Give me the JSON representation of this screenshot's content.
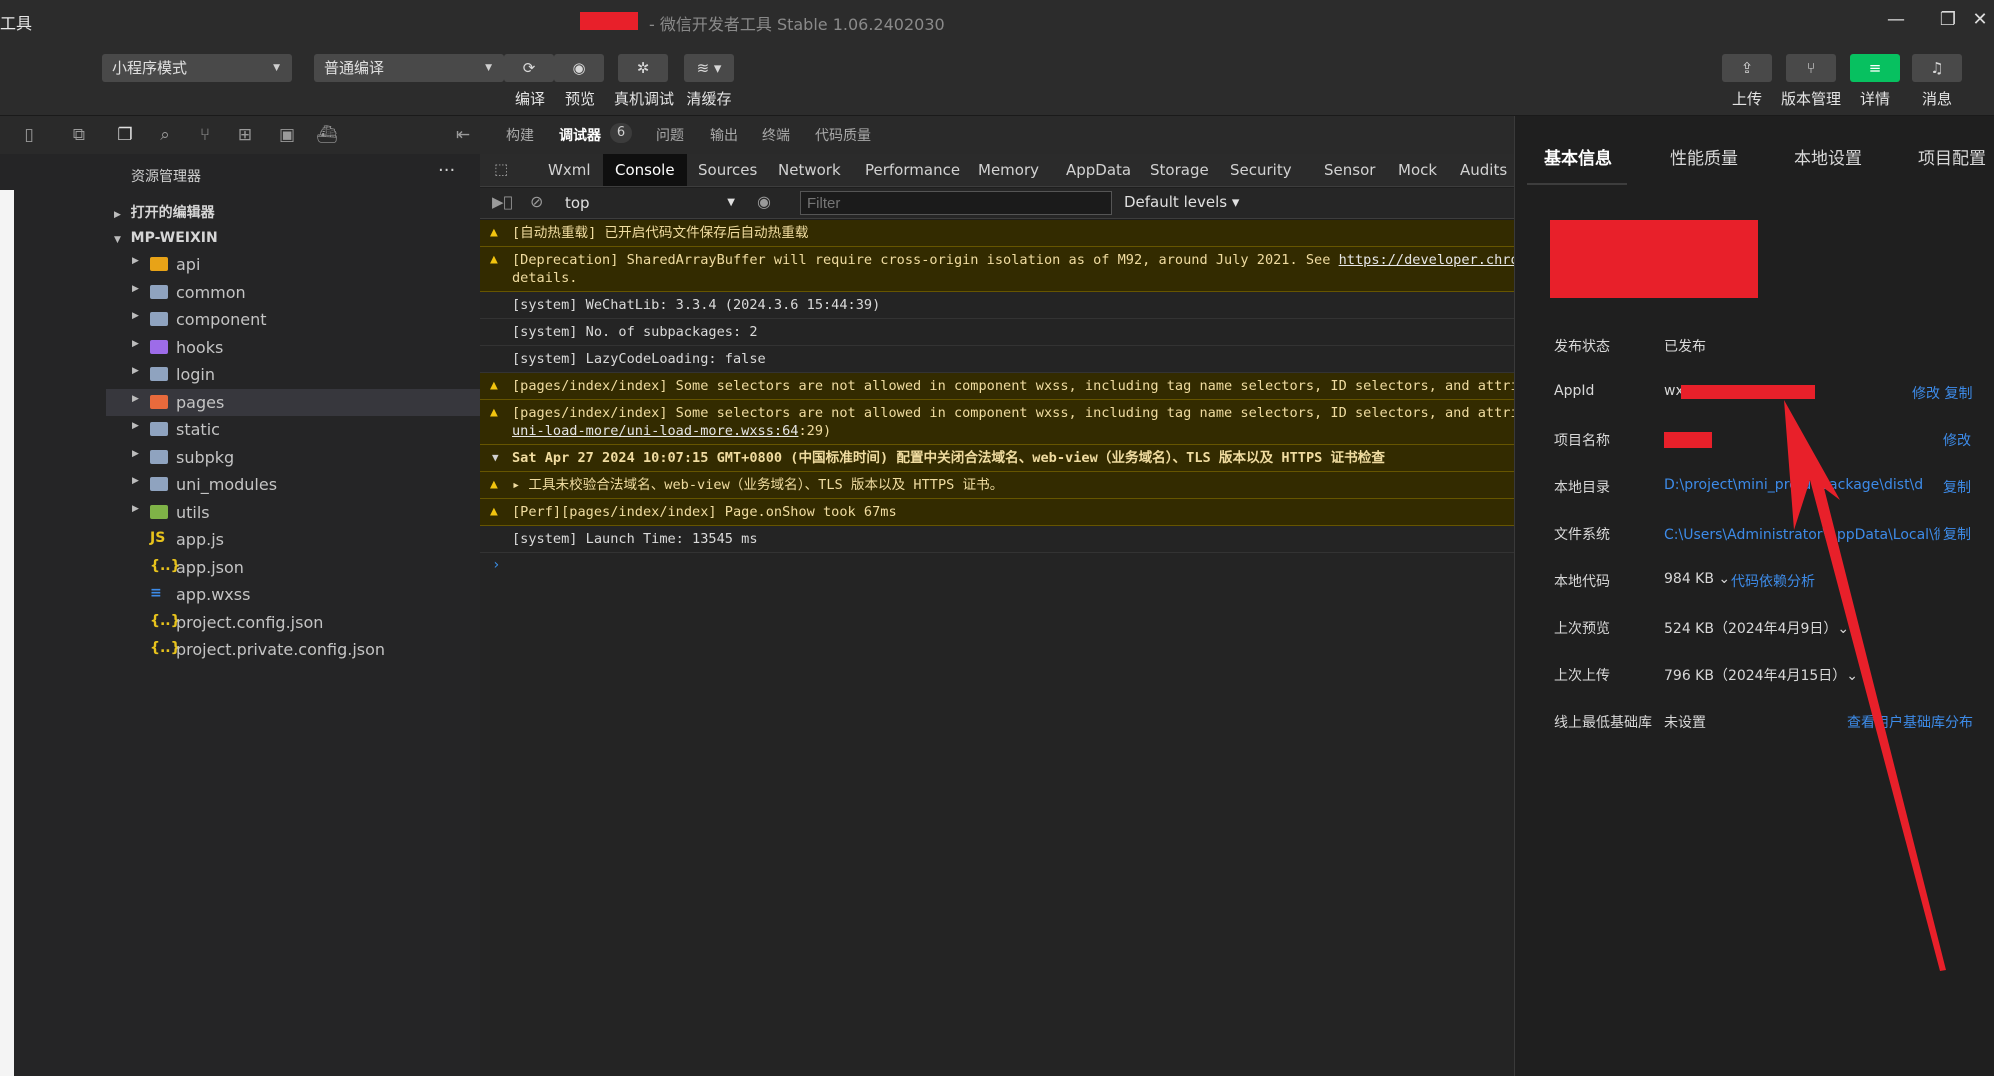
{
  "titlebar": {
    "app_label": "工具",
    "window_title": "- 微信开发者工具 Stable 1.06.2402030",
    "minimize": "—",
    "maximize": "❐",
    "close": "✕"
  },
  "toolbar": {
    "mode_select": "小程序模式",
    "compile_select": "普通编译",
    "buttons": {
      "compile": "编译",
      "preview": "预览",
      "device_debug": "真机调试",
      "clear_cache": "清缓存",
      "upload": "上传",
      "version": "版本管理",
      "details": "详情",
      "messages": "消息"
    }
  },
  "explorer": {
    "title": "资源管理器",
    "more": "···",
    "open_editors": "打开的编辑器",
    "project": "MP-WEIXIN",
    "items": [
      {
        "name": "api",
        "type": "folder",
        "color": "#e8a317"
      },
      {
        "name": "common",
        "type": "folder",
        "color": "#8fa3bf"
      },
      {
        "name": "component",
        "type": "folder",
        "color": "#8fa3bf"
      },
      {
        "name": "hooks",
        "type": "folder",
        "color": "#9d6ce8"
      },
      {
        "name": "login",
        "type": "folder",
        "color": "#8fa3bf"
      },
      {
        "name": "pages",
        "type": "folder",
        "color": "#e86a3c"
      },
      {
        "name": "static",
        "type": "folder",
        "color": "#8fa3bf"
      },
      {
        "name": "subpkg",
        "type": "folder",
        "color": "#8fa3bf"
      },
      {
        "name": "uni_modules",
        "type": "folder",
        "color": "#8fa3bf"
      },
      {
        "name": "utils",
        "type": "folder",
        "color": "#7fb347"
      },
      {
        "name": "app.js",
        "type": "js",
        "glyph": "JS",
        "color": "#e8c31c"
      },
      {
        "name": "app.json",
        "type": "json",
        "glyph": "{..}",
        "color": "#e8c31c"
      },
      {
        "name": "app.wxss",
        "type": "css",
        "glyph": "≡",
        "color": "#3d8be8"
      },
      {
        "name": "project.config.json",
        "type": "json",
        "glyph": "{..}",
        "color": "#e8c31c"
      },
      {
        "name": "project.private.config.json",
        "type": "json",
        "glyph": "{..}",
        "color": "#e8c31c"
      }
    ]
  },
  "devtools": {
    "top_tabs": [
      "构建",
      "调试器",
      "问题",
      "输出",
      "终端",
      "代码质量"
    ],
    "debugger_badge": "6",
    "panel_tabs": [
      "Wxml",
      "Console",
      "Sources",
      "Network",
      "Performance",
      "Memory",
      "AppData",
      "Storage",
      "Security",
      "Sensor",
      "Mock",
      "Audits"
    ],
    "context": "top",
    "filter_placeholder": "Filter",
    "levels": "Default levels ▾"
  },
  "console": {
    "logs": [
      {
        "level": "warn",
        "text": "[自动热重载] 已开启代码文件保存后自动热重载"
      },
      {
        "level": "warn",
        "text": "[Deprecation] SharedArrayBuffer will require cross-origin isolation as of M92, around July 2021. See ",
        "link": "https://developer.chrome.com/blog/enabling-shared-array-buffer/",
        "text2": "details."
      },
      {
        "level": "info",
        "text": "[system] WeChatLib: 3.3.4 (2024.3.6 15:44:39)"
      },
      {
        "level": "info",
        "text": "[system] No. of subpackages: 2"
      },
      {
        "level": "info",
        "text": "[system] LazyCodeLoading: false"
      },
      {
        "level": "warn",
        "text": "[pages/index/index] Some selectors are not allowed in component wxss, including tag name selectors, ID selectors, and attribute selectors."
      },
      {
        "level": "warn",
        "text": "[pages/index/index] Some selectors are not allowed in component wxss, including tag name selectors, ID selectors, and attribute selectors.",
        "link2": "uni-load-more/uni-load-more.wxss:64",
        "text2": ":29)"
      },
      {
        "level": "group",
        "text": "Sat Apr 27 2024 10:07:15 GMT+0800 (中国标准时间) 配置中关闭合法域名、web-view（业务域名）、TLS 版本以及 HTTPS 证书检查"
      },
      {
        "level": "warn",
        "text": "▸ 工具未校验合法域名、web-view（业务域名）、TLS 版本以及 HTTPS 证书。"
      },
      {
        "level": "warn",
        "text": "[Perf][pages/index/index] Page.onShow took 67ms"
      },
      {
        "level": "info",
        "text": "[system] Launch Time: 13545 ms"
      }
    ],
    "prompt": "›"
  },
  "right_panel": {
    "tabs": [
      "基本信息",
      "性能质量",
      "本地设置",
      "项目配置"
    ],
    "rows": {
      "publish_status": {
        "label": "发布状态",
        "value": "已发布"
      },
      "appid": {
        "label": "AppId",
        "value": "wx",
        "actions": "修改 复制"
      },
      "project_name": {
        "label": "项目名称",
        "actions": "修改"
      },
      "local_dir": {
        "label": "本地目录",
        "value": "D:\\project\\mini_pro\\unpackage\\dist\\dev\\m...",
        "actions": "复制"
      },
      "file_system": {
        "label": "文件系统",
        "value": "C:\\Users\\Administrator\\AppData\\Local\\微信...",
        "actions": "复制"
      },
      "local_code": {
        "label": "本地代码",
        "value": "984 KB ⌄",
        "link": "代码依赖分析"
      },
      "last_preview": {
        "label": "上次预览",
        "value": "524 KB（2024年4月9日）⌄"
      },
      "last_upload": {
        "label": "上次上传",
        "value": "796 KB（2024年4月15日）⌄"
      },
      "min_lib": {
        "label": "线上最低基础库",
        "value": "未设置",
        "link": "查看用户基础库分布"
      }
    }
  },
  "colors": {
    "accent_green": "#07c160",
    "annotation_red": "#e8202a",
    "link_blue": "#3d8be8",
    "warning_yellow": "#f2c40f"
  }
}
